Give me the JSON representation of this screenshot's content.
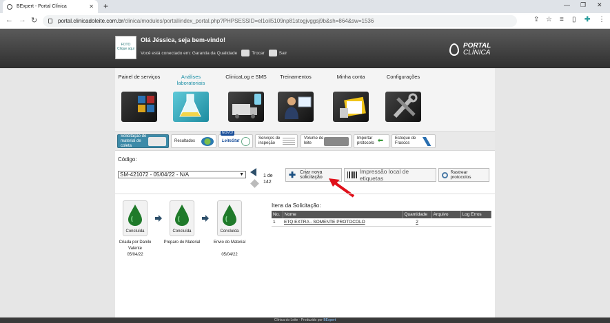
{
  "browser": {
    "tab_title": "BExpert - Portal Clínica",
    "url_host": "portal.clinicadoleite.com.br",
    "url_path": "/clinica/modules/portal/index_portal.php?PHPSESSID=el1oil5109np81stogjvggsj9b&sh=864&sw=1536"
  },
  "header": {
    "avatar_text": "FOTO Clique aqui",
    "greeting": "Olá Jéssica, seja bem-vindo!",
    "connected_label": "Você está conectado em:",
    "connected_value": "Garantia da Qualidade",
    "switch_label": "Trocar",
    "logout_label": "Sair",
    "logo_line1": "PORTAL",
    "logo_line2": "CLÍNICA"
  },
  "menu": {
    "items": [
      {
        "label": "Painel de serviços",
        "icon": "dashboard-icon"
      },
      {
        "label": "Análises laboratoriais",
        "icon": "lab-flask-icon"
      },
      {
        "label": "ClinicaLog e SMS",
        "icon": "truck-sms-icon"
      },
      {
        "label": "Treinamentos",
        "icon": "presenter-icon"
      },
      {
        "label": "Minha conta",
        "icon": "account-folder-icon"
      },
      {
        "label": "Configurações",
        "icon": "tools-icon"
      }
    ]
  },
  "submenu": {
    "items": [
      {
        "label": "Solicitação de material de coleta"
      },
      {
        "label": "Resultados"
      },
      {
        "label": "LeiteStat",
        "badge": "NOVO!"
      },
      {
        "label": "Serviços de inspeção"
      },
      {
        "label": "Volume de leite"
      },
      {
        "label": "Importar protocolos"
      },
      {
        "label": "Estoque de Frascos"
      }
    ]
  },
  "form": {
    "code_label": "Código:",
    "selected_code": "SM-421072 - 05/04/22 - N/A",
    "pager_line1": "1 de",
    "pager_line2": "142",
    "btn_new": "Criar nova solicitação",
    "btn_print": "Impressão local de etiquetas",
    "btn_track": "Rastrear protocolos"
  },
  "steps": [
    {
      "status": "Concluída",
      "desc": "Criada por Danilo Valente",
      "date": "05/04/22"
    },
    {
      "status": "Concluída",
      "desc": "Preparo do Material",
      "date": ""
    },
    {
      "status": "Concluída",
      "desc": "Envio do Material",
      "date": "05/04/22"
    }
  ],
  "items_table": {
    "title": "Itens da Solicitação:",
    "headers": [
      "No.",
      "Nome",
      "Quantidade",
      "Arquivo",
      "Log Erros"
    ],
    "rows": [
      {
        "no": "1",
        "nome": "ETQ EXTRA - SOMENTE PROTOCOLO",
        "quantidade": "2",
        "arquivo": "",
        "log": ""
      }
    ]
  },
  "footer": {
    "text": "Clínica do Leite - Produzido por",
    "brand": "BExpert"
  },
  "colors": {
    "accent": "#1a8fa6",
    "header_dark": "#2f2f2f",
    "drop_green": "#1f7a2a",
    "arrow_red": "#e0101a"
  }
}
